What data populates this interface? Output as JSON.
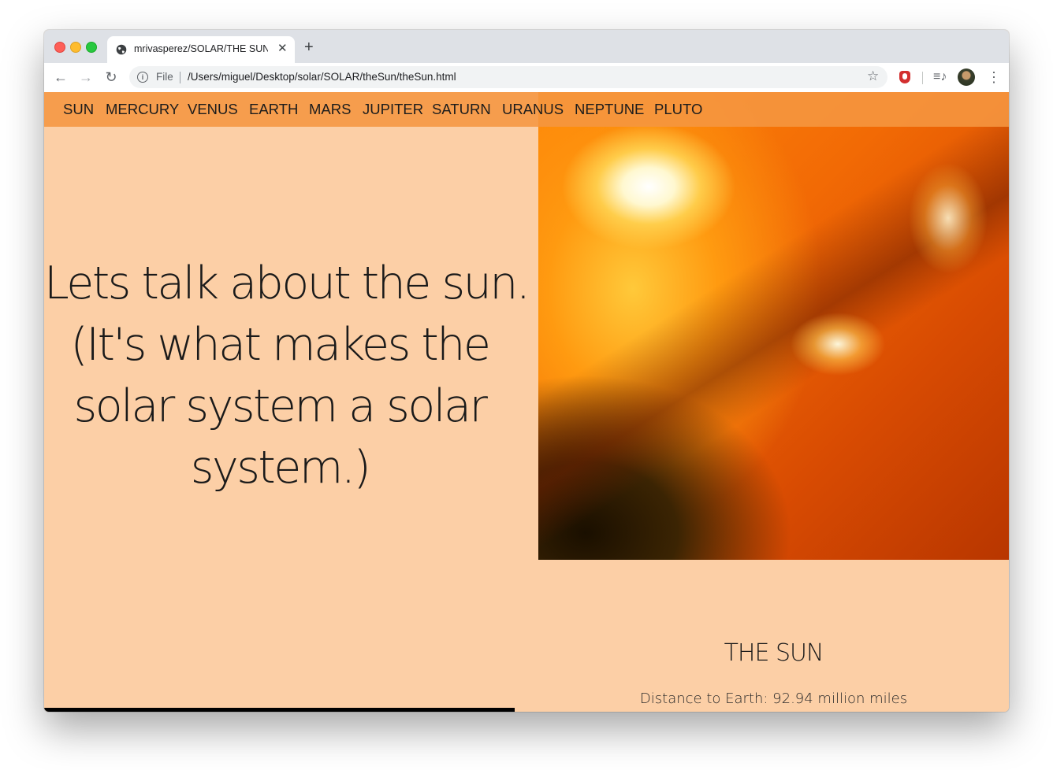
{
  "browser": {
    "tab_title": "mrivasperez/SOLAR/THE SUN",
    "tab_close": "✕",
    "new_tab": "+",
    "url_scheme": "File",
    "url": "/Users/miguel/Desktop/solar/SOLAR/theSun/theSun.html",
    "icons": {
      "back": "←",
      "forward": "→",
      "reload": "↻",
      "info": "i",
      "star": "☆",
      "media": "≡♪",
      "menu": "⋮"
    }
  },
  "nav": {
    "items": [
      "SUN",
      "MERCURY",
      "VENUS",
      "EARTH",
      "MARS",
      "JUPITER",
      "SATURN",
      "URANUS",
      "NEPTUNE",
      "PLUTO"
    ]
  },
  "hero": {
    "lines": [
      "Lets talk about the sun.",
      "(It's what makes the",
      "solar system a solar",
      "system.)"
    ]
  },
  "info": {
    "title": "THE SUN",
    "distance": "Distance to Earth: 92.94 million miles"
  },
  "colors": {
    "page_background": "#fccfa6",
    "navbar": "#f5963f",
    "text": "#1a1a1a"
  }
}
